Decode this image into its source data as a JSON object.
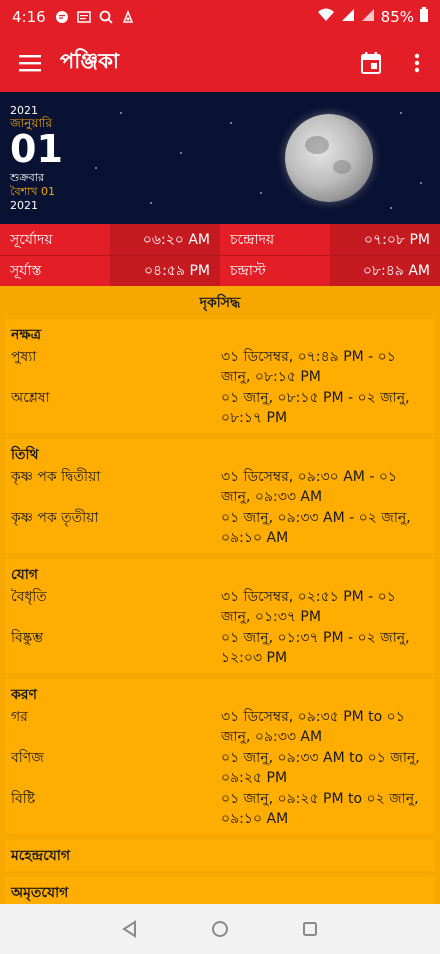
{
  "statusbar": {
    "time": "4:16",
    "battery": "85%"
  },
  "appbar": {
    "title": "পঞ্জিকা"
  },
  "hero": {
    "year_top": "2021",
    "month": "জানুয়ারি",
    "day": "01",
    "weekday": "শুক্রবার",
    "bengali_date": "বৈশাখ 01",
    "year_bottom": "2021"
  },
  "times": [
    {
      "l_label": "সূর্যোদয়",
      "l_value": "০৬:২০ AM",
      "r_label": "চন্দ্রোদয়",
      "r_value": "০৭:০৮ PM"
    },
    {
      "l_label": "সূর্যাস্ত",
      "l_value": "০৪:৫৯ PM",
      "r_label": "চন্দ্রাস্ট",
      "r_value": "০৮:৪৯ AM"
    }
  ],
  "section_title": "দৃকসিদ্ধ",
  "cards": [
    {
      "title": "নক্ষত্র",
      "rows": [
        {
          "name": "পুষ্যা",
          "value": "৩১ ডিসেম্বর, ০৭:৪৯ PM - ০১ জানু, ০৮:১৫ PM"
        },
        {
          "name": "অশ্লেষা",
          "value": "০১ জানু, ০৮:১৫ PM - ০২ জানু, ০৮:১৭ PM"
        }
      ]
    },
    {
      "title": "তিথি",
      "rows": [
        {
          "name": "কৃষ্ণ পক দ্বিতীয়া",
          "value": "৩১ ডিসেম্বর, ০৯:৩০ AM - ০১ জানু, ০৯:৩৩ AM"
        },
        {
          "name": "কৃষ্ণ পক তৃতীয়া",
          "value": "০১ জানু, ০৯:৩৩ AM - ০২ জানু, ০৯:১০ AM"
        }
      ]
    },
    {
      "title": "যোগ",
      "rows": [
        {
          "name": "বৈধৃতি",
          "value": "৩১ ডিসেম্বর, ০২:৫১ PM - ০১ জানু, ০১:৩৭ PM"
        },
        {
          "name": "বিষ্কুম্ভ",
          "value": "০১ জানু, ০১:৩৭ PM - ০২ জানু, ১২:০৩ PM"
        }
      ]
    },
    {
      "title": "করণ",
      "rows": [
        {
          "name": "গর",
          "value": "৩১ ডিসেম্বর, ০৯:৩৫ PM to ০১ জানু, ০৯:৩৩ AM"
        },
        {
          "name": "বণিজ",
          "value": "০১ জানু, ০৯:৩৩ AM to ০১ জানু, ০৯:২৫ PM"
        },
        {
          "name": "বিষ্টি",
          "value": "০১ জানু, ০৯:২৫ PM to ০২ জানু, ০৯:১০ AM"
        }
      ]
    }
  ],
  "extra_sections": [
    "মহেন্দ্রযোগ",
    "অমৃতযোগ"
  ]
}
